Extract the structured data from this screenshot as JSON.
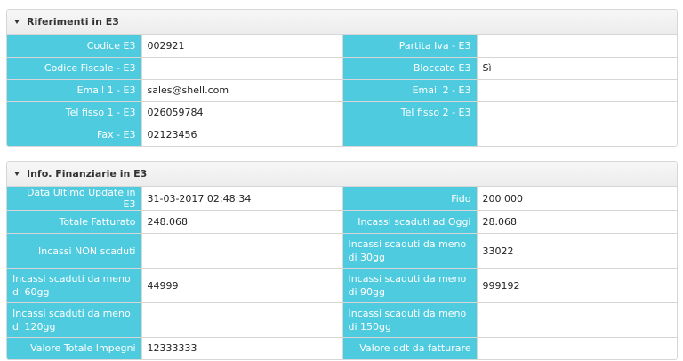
{
  "riferimenti": {
    "title": "Riferimenti in E3",
    "rows": [
      {
        "l1": "Codice E3",
        "v1": "002921",
        "l2": "Partita Iva - E3",
        "v2": ""
      },
      {
        "l1": "Codice Fiscale - E3",
        "v1": "",
        "l2": "Bloccato E3",
        "v2": "Sì"
      },
      {
        "l1": "Email 1 - E3",
        "v1": "sales@shell.com",
        "l2": "Email 2 - E3",
        "v2": ""
      },
      {
        "l1": "Tel fisso 1 - E3",
        "v1": "026059784",
        "l2": "Tel fisso 2 - E3",
        "v2": ""
      },
      {
        "l1": "Fax - E3",
        "v1": "02123456",
        "l2": "",
        "v2": ""
      }
    ]
  },
  "finanziarie": {
    "title": "Info. Finanziarie in E3",
    "rows": [
      {
        "l1": "Data Ultimo Update in E3",
        "v1": "31-03-2017 02:48:34",
        "l2": "Fido",
        "v2": "200 000"
      },
      {
        "l1": "Totale Fatturato",
        "v1": "248.068",
        "l2": "Incassi scaduti ad Oggi",
        "v2": "28.068"
      },
      {
        "l1": "Incassi NON scaduti",
        "v1": "",
        "l2": "Incassi scaduti da meno di 30gg",
        "v2": "33022"
      },
      {
        "l1": "Incassi scaduti da meno di 60gg",
        "v1": "44999",
        "l2": "Incassi scaduti da meno di 90gg",
        "v2": "999192"
      },
      {
        "l1": "Incassi scaduti da meno di 120gg",
        "v1": "",
        "l2": "Incassi scaduti da meno di 150gg",
        "v2": ""
      },
      {
        "l1": "Valore Totale Impegni",
        "v1": "12333333",
        "l2": "Valore ddt da fatturare",
        "v2": ""
      }
    ]
  }
}
